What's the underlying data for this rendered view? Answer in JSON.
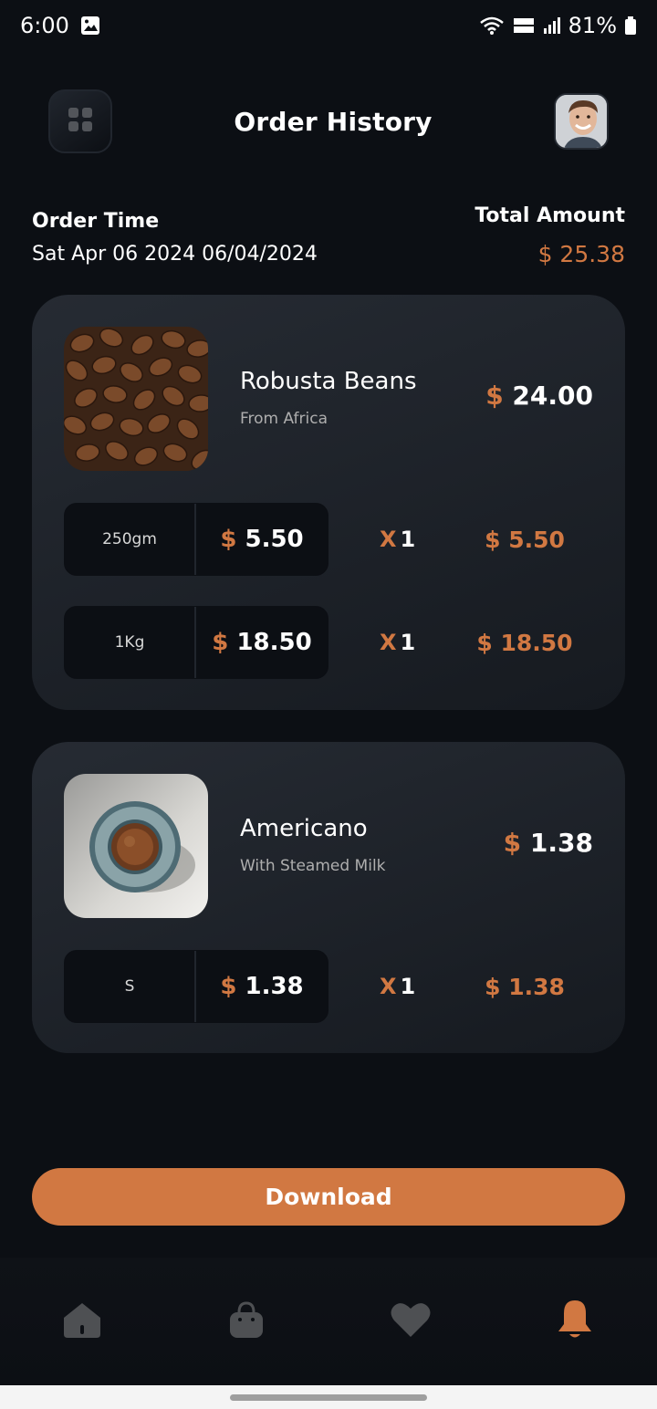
{
  "status": {
    "time": "6:00",
    "battery": "81%"
  },
  "header": {
    "title": "Order History"
  },
  "order": {
    "time_label": "Order Time",
    "time_value": "Sat Apr 06 2024 06/04/2024",
    "total_label": "Total Amount",
    "total_value": "$ 25.38"
  },
  "items": [
    {
      "name": "Robusta Beans",
      "subtitle": "From Africa",
      "currency": "$",
      "price": "24.00",
      "sizes": [
        {
          "size": "250gm",
          "currency": "$",
          "price": "5.50",
          "qty_x": "X",
          "qty": "1",
          "total": "$ 5.50"
        },
        {
          "size": "1Kg",
          "currency": "$",
          "price": "18.50",
          "qty_x": "X",
          "qty": "1",
          "total": "$ 18.50"
        }
      ]
    },
    {
      "name": "Americano",
      "subtitle": "With Steamed Milk",
      "currency": "$",
      "price": "1.38",
      "sizes": [
        {
          "size": "S",
          "currency": "$",
          "price": "1.38",
          "qty_x": "X",
          "qty": "1",
          "total": "$ 1.38"
        }
      ]
    }
  ],
  "actions": {
    "download_label": "Download"
  },
  "nav": {
    "items": [
      "home-icon",
      "bag-icon",
      "heart-icon",
      "bell-icon"
    ],
    "active": "bell-icon",
    "inactive_color": "#4e5053",
    "active_color": "#d17842"
  },
  "colors": {
    "accent": "#d17842",
    "background": "#0c0f14"
  }
}
